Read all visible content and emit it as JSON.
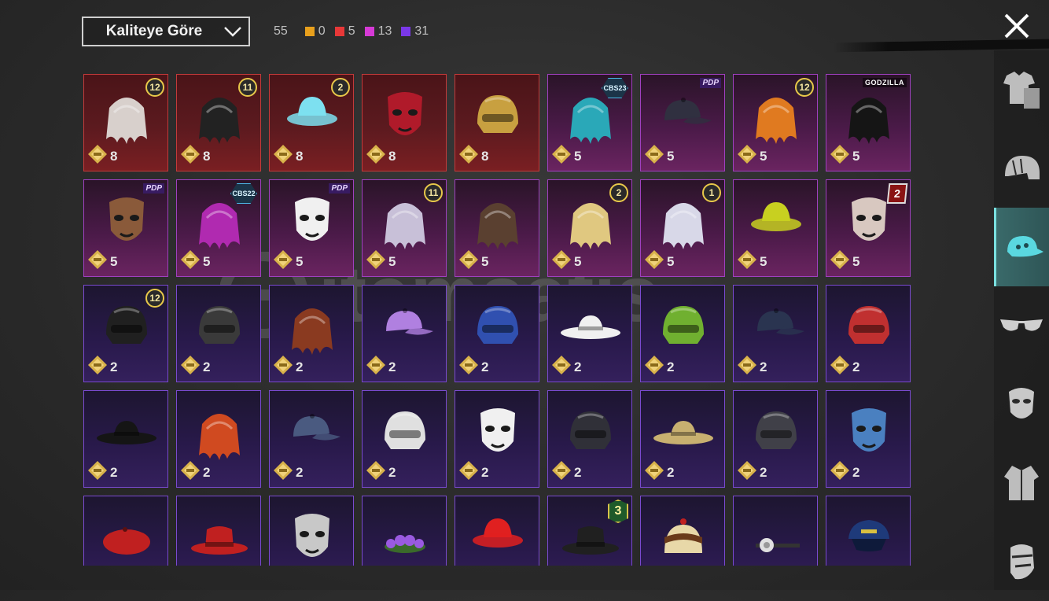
{
  "header": {
    "sort_label": "Kaliteye Göre",
    "total": "55",
    "counts": [
      {
        "color": "#e8a01c",
        "value": "0"
      },
      {
        "color": "#e83838",
        "value": "5"
      },
      {
        "color": "#d63ad6",
        "value": "13"
      },
      {
        "color": "#7a38e8",
        "value": "31"
      }
    ]
  },
  "sidebar": {
    "tabs": [
      "outfit-icon",
      "helmet-icon",
      "cap-icon",
      "glasses-icon",
      "mask-icon",
      "jacket-icon",
      "face-icon"
    ],
    "active": 2
  },
  "watermark": "itemsatis",
  "items": [
    {
      "rarity": "red",
      "qty": "8",
      "badge_type": "circle",
      "badge": "12",
      "art": "hair",
      "color": "#d8d0cc"
    },
    {
      "rarity": "red",
      "qty": "8",
      "badge_type": "circle",
      "badge": "11",
      "art": "hair",
      "color": "#222"
    },
    {
      "rarity": "red",
      "qty": "8",
      "badge_type": "circle",
      "badge": "2",
      "art": "bucket",
      "color": "#7de0f0"
    },
    {
      "rarity": "red",
      "qty": "8",
      "badge_type": "",
      "badge": "",
      "art": "mask",
      "color": "#b01a2a"
    },
    {
      "rarity": "red",
      "qty": "8",
      "badge_type": "",
      "badge": "",
      "art": "helm",
      "color": "#c8a040"
    },
    {
      "rarity": "purple",
      "qty": "5",
      "badge_type": "hex",
      "badge": "CBS23",
      "art": "hair",
      "color": "#2aa8b8"
    },
    {
      "rarity": "purple",
      "qty": "5",
      "badge_type": "text",
      "badge": "PDP",
      "art": "cap",
      "color": "#303040"
    },
    {
      "rarity": "purple",
      "qty": "5",
      "badge_type": "circle",
      "badge": "12",
      "art": "hair",
      "color": "#e07a20"
    },
    {
      "rarity": "purple",
      "qty": "5",
      "badge_type": "textw",
      "badge": "GODZILLA",
      "art": "hair",
      "color": "#151515"
    },
    {
      "rarity": "purple",
      "qty": "5",
      "badge_type": "text",
      "badge": "PDP",
      "art": "mask",
      "color": "#8a5a3a"
    },
    {
      "rarity": "purple",
      "qty": "5",
      "badge_type": "hex",
      "badge": "CBS22",
      "art": "hair",
      "color": "#b02ab0"
    },
    {
      "rarity": "purple",
      "qty": "5",
      "badge_type": "text",
      "badge": "PDP",
      "art": "mask",
      "color": "#f0f0f0"
    },
    {
      "rarity": "purple",
      "qty": "5",
      "badge_type": "circle",
      "badge": "11",
      "art": "hair",
      "color": "#c8c0d8"
    },
    {
      "rarity": "purple",
      "qty": "5",
      "badge_type": "",
      "badge": "",
      "art": "hair",
      "color": "#5a4030"
    },
    {
      "rarity": "purple",
      "qty": "5",
      "badge_type": "circle",
      "badge": "2",
      "art": "hair",
      "color": "#e0c880"
    },
    {
      "rarity": "purple",
      "qty": "5",
      "badge_type": "circle",
      "badge": "1",
      "art": "hair",
      "color": "#d8d8e8"
    },
    {
      "rarity": "purple",
      "qty": "5",
      "badge_type": "",
      "badge": "",
      "art": "bucket",
      "color": "#c8d020"
    },
    {
      "rarity": "purple",
      "qty": "5",
      "badge_type": "red",
      "badge": "2",
      "art": "mask",
      "color": "#d8c8c0"
    },
    {
      "rarity": "violet",
      "qty": "2",
      "badge_type": "circle",
      "badge": "12",
      "art": "helm",
      "color": "#202020"
    },
    {
      "rarity": "violet",
      "qty": "2",
      "badge_type": "",
      "badge": "",
      "art": "helm",
      "color": "#3a3a3a"
    },
    {
      "rarity": "violet",
      "qty": "2",
      "badge_type": "",
      "badge": "",
      "art": "hair",
      "color": "#8a3a20"
    },
    {
      "rarity": "violet",
      "qty": "2",
      "badge_type": "",
      "badge": "",
      "art": "cap",
      "color": "#b080e0"
    },
    {
      "rarity": "violet",
      "qty": "2",
      "badge_type": "",
      "badge": "",
      "art": "helm",
      "color": "#3050b0"
    },
    {
      "rarity": "violet",
      "qty": "2",
      "badge_type": "",
      "badge": "",
      "art": "wide",
      "color": "#f0f0f0"
    },
    {
      "rarity": "violet",
      "qty": "2",
      "badge_type": "",
      "badge": "",
      "art": "helm",
      "color": "#70b030"
    },
    {
      "rarity": "violet",
      "qty": "2",
      "badge_type": "",
      "badge": "",
      "art": "cap",
      "color": "#2a3450"
    },
    {
      "rarity": "violet",
      "qty": "2",
      "badge_type": "",
      "badge": "",
      "art": "helm",
      "color": "#c03030"
    },
    {
      "rarity": "violet",
      "qty": "2",
      "badge_type": "",
      "badge": "",
      "art": "wide",
      "color": "#151515"
    },
    {
      "rarity": "violet",
      "qty": "2",
      "badge_type": "",
      "badge": "",
      "art": "hair",
      "color": "#d04a20"
    },
    {
      "rarity": "violet",
      "qty": "2",
      "badge_type": "",
      "badge": "",
      "art": "cap",
      "color": "#4a5a80"
    },
    {
      "rarity": "violet",
      "qty": "2",
      "badge_type": "",
      "badge": "",
      "art": "helm",
      "color": "#e0e0e0"
    },
    {
      "rarity": "violet",
      "qty": "2",
      "badge_type": "",
      "badge": "",
      "art": "mask",
      "color": "#f0f0f0"
    },
    {
      "rarity": "violet",
      "qty": "2",
      "badge_type": "",
      "badge": "",
      "art": "helm",
      "color": "#303038"
    },
    {
      "rarity": "violet",
      "qty": "2",
      "badge_type": "",
      "badge": "",
      "art": "wide",
      "color": "#c8b070"
    },
    {
      "rarity": "violet",
      "qty": "2",
      "badge_type": "",
      "badge": "",
      "art": "helm",
      "color": "#404048"
    },
    {
      "rarity": "violet",
      "qty": "2",
      "badge_type": "",
      "badge": "",
      "art": "mask",
      "color": "#4a80c0"
    },
    {
      "rarity": "violet",
      "qty": "",
      "badge_type": "",
      "badge": "",
      "art": "beret",
      "color": "#c02020"
    },
    {
      "rarity": "violet",
      "qty": "",
      "badge_type": "",
      "badge": "",
      "art": "fedora",
      "color": "#c02020"
    },
    {
      "rarity": "violet",
      "qty": "",
      "badge_type": "",
      "badge": "",
      "art": "mask",
      "color": "#c8c8c8"
    },
    {
      "rarity": "violet",
      "qty": "",
      "badge_type": "",
      "badge": "",
      "art": "flower",
      "color": "#9a5ae0"
    },
    {
      "rarity": "violet",
      "qty": "",
      "badge_type": "",
      "badge": "",
      "art": "bucket",
      "color": "#e02020"
    },
    {
      "rarity": "violet",
      "qty": "",
      "badge_type": "green",
      "badge": "3",
      "art": "fedora",
      "color": "#202020"
    },
    {
      "rarity": "violet",
      "qty": "",
      "badge_type": "",
      "badge": "",
      "art": "cake",
      "color": "#e8d8a8"
    },
    {
      "rarity": "violet",
      "qty": "",
      "badge_type": "",
      "badge": "",
      "art": "lamp",
      "color": "#e0e0e0"
    },
    {
      "rarity": "violet",
      "qty": "",
      "badge_type": "",
      "badge": "",
      "art": "peak",
      "color": "#1e3a7a"
    }
  ]
}
